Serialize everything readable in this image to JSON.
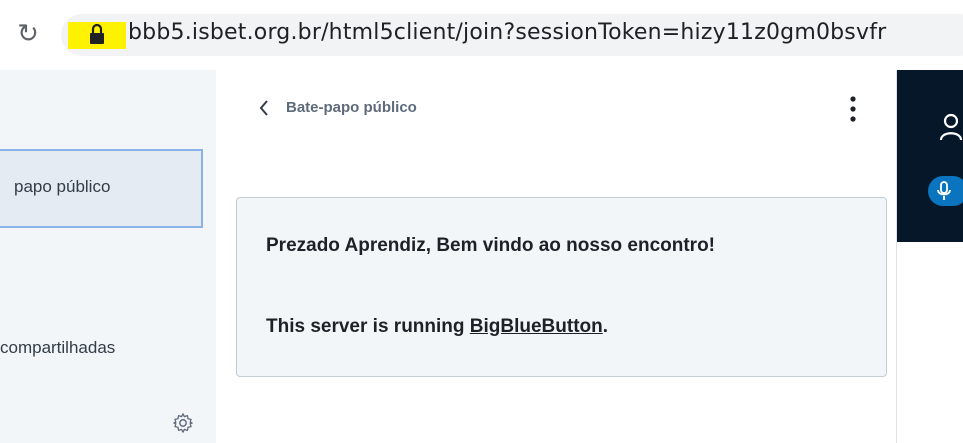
{
  "browser": {
    "url": "bbb5.isbet.org.br/html5client/join?sessionToken=hizy11z0gm0bsvfr",
    "reload_icon": "reload-icon",
    "lock_icon": "lock-icon",
    "highlight_color": "#fff200"
  },
  "left_panel": {
    "active_item_label": "papo público",
    "shared_notes_label": "compartilhadas",
    "settings_icon": "gear-icon"
  },
  "chat": {
    "title": "Bate-papo público",
    "back_icon": "chevron-left-icon",
    "options_icon": "kebab-menu-icon",
    "welcome_message": "Prezado Aprendiz, Bem vindo ao nosso encontro!",
    "server_prefix": "This server is running ",
    "server_link": "BigBlueButton",
    "server_suffix": "."
  },
  "right_panel": {
    "user_icon": "user-icon",
    "mic_icon": "microphone-icon",
    "accent_color": "#0b74bf",
    "bg_color": "#06172a"
  }
}
